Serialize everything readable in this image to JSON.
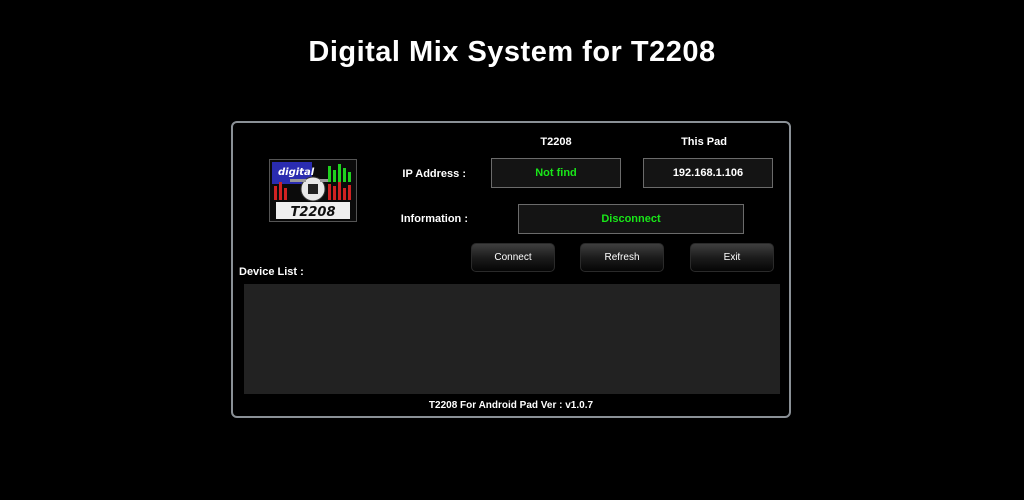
{
  "header": {
    "title": "Digital Mix System for T2208"
  },
  "logo": {
    "brand_text": "digital",
    "model_text": "T2208"
  },
  "columns": {
    "device": "T2208",
    "this_pad": "This Pad"
  },
  "ip_address": {
    "label": "IP Address :",
    "device_value": "Not find",
    "pad_value": "192.168.1.106"
  },
  "information": {
    "label": "Information :",
    "value": "Disconnect"
  },
  "buttons": {
    "connect": "Connect",
    "refresh": "Refresh",
    "exit": "Exit"
  },
  "device_list": {
    "label": "Device List :"
  },
  "footer": {
    "version": "T2208 For Android Pad Ver : v1.0.7"
  },
  "colors": {
    "status_green": "#19e619",
    "panel_border": "#8a9096"
  }
}
